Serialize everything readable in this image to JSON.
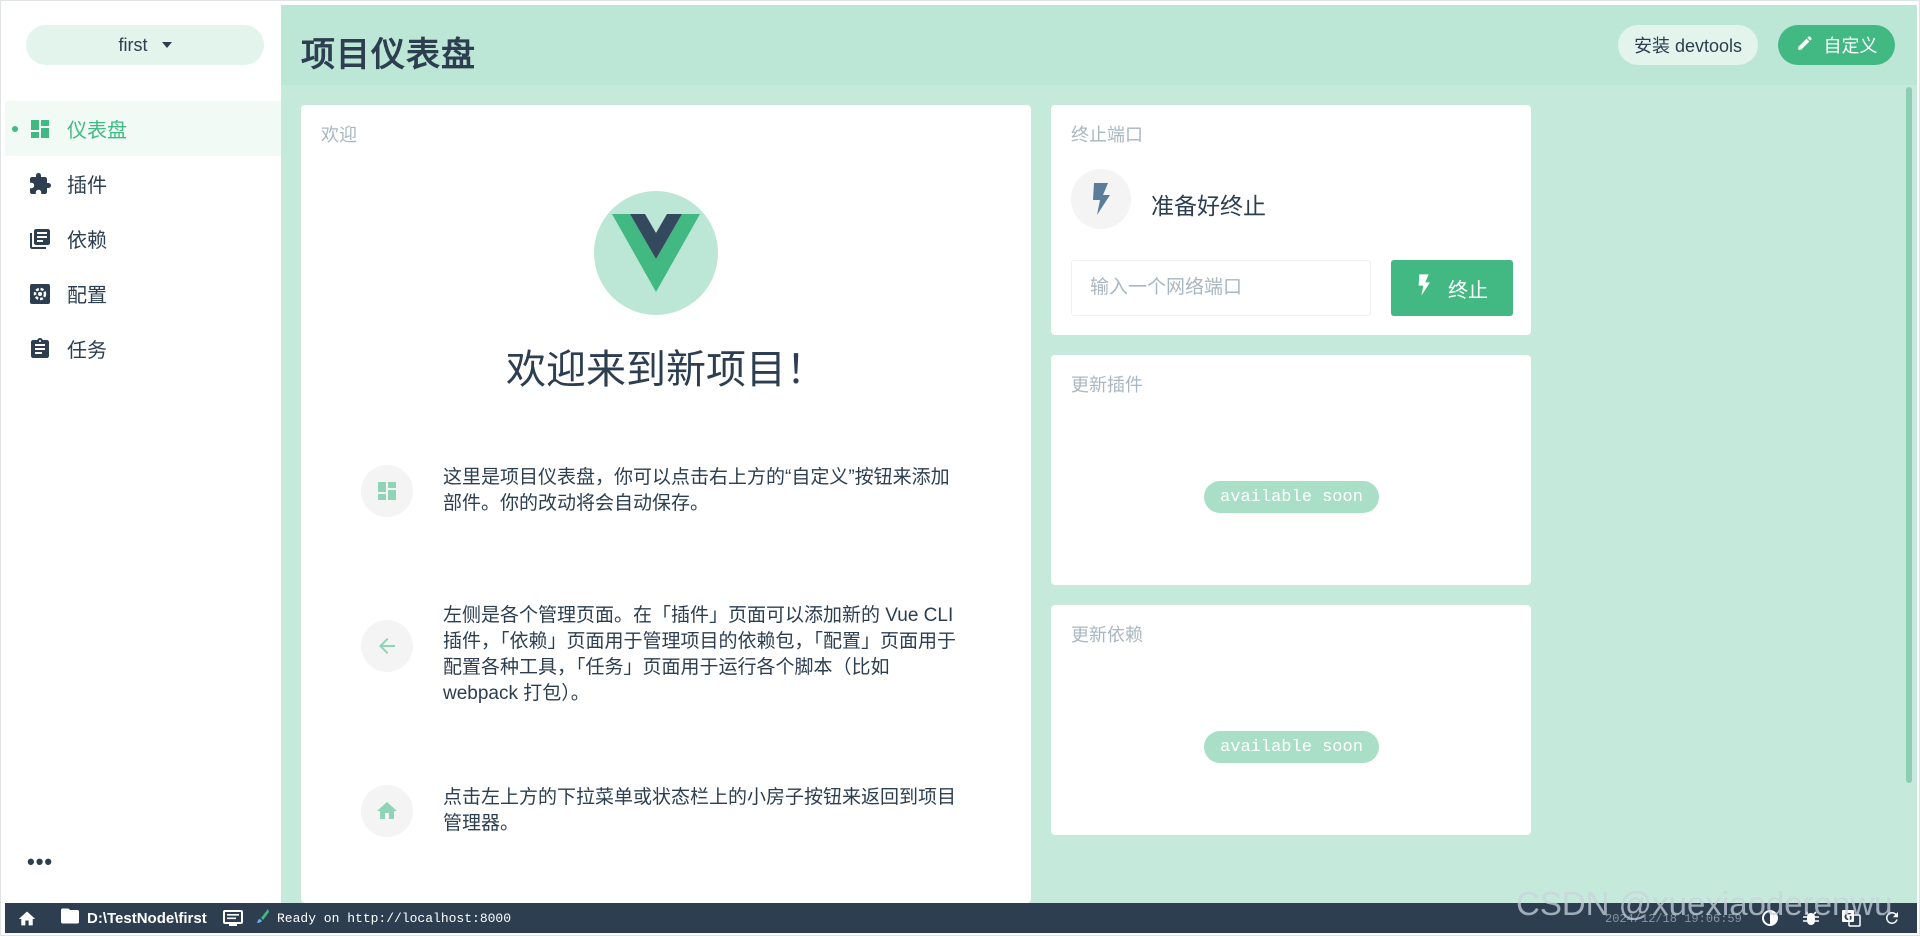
{
  "sidebar": {
    "project_name": "first",
    "items": [
      {
        "label": "仪表盘",
        "icon": "dashboard-icon",
        "active": true
      },
      {
        "label": "插件",
        "icon": "puzzle-icon",
        "active": false
      },
      {
        "label": "依赖",
        "icon": "library-books-icon",
        "active": false
      },
      {
        "label": "配置",
        "icon": "settings-box-icon",
        "active": false
      },
      {
        "label": "任务",
        "icon": "clipboard-icon",
        "active": false
      }
    ],
    "more_label": "•••"
  },
  "header": {
    "title": "项目仪表盘",
    "devtools_label": "安装 devtools",
    "customize_label": "自定义"
  },
  "welcome": {
    "card_title": "欢迎",
    "title": "欢迎来到新项目！",
    "tips": [
      {
        "icon": "dashboard-icon",
        "text": "这里是项目仪表盘，你可以点击右上方的“自定义”按钮来添加部件。你的改动将会自动保存。"
      },
      {
        "icon": "arrow-left-icon",
        "text": "左侧是各个管理页面。在「插件」页面可以添加新的 Vue CLI 插件，「依赖」页面用于管理项目的依赖包，「配置」页面用于配置各种工具，「任务」页面用于运行各个脚本（比如 webpack 打包）。"
      },
      {
        "icon": "home-icon",
        "text": "点击左上方的下拉菜单或状态栏上的小房子按钮来返回到项目管理器。"
      }
    ]
  },
  "kill_port": {
    "card_title": "终止端口",
    "status": "准备好终止",
    "input_placeholder": "输入一个网络端口",
    "button_label": "终止"
  },
  "update_plugins": {
    "card_title": "更新插件",
    "badge": "available soon"
  },
  "update_deps": {
    "card_title": "更新依赖",
    "badge": "available soon"
  },
  "statusbar": {
    "folder": "D:\\TestNode\\first",
    "ready_text": "Ready on http://localhost:8000",
    "time": "2024/12/18 19:06:59"
  },
  "watermark": "CSDN @xuexiaoderenwu",
  "colors": {
    "accent": "#42b983",
    "main_bg": "#c5e9db",
    "header_bg": "#bce7d6",
    "statusbar_bg": "#2c3e50",
    "text": "#2c3e50",
    "muted": "#a9b7c1"
  }
}
